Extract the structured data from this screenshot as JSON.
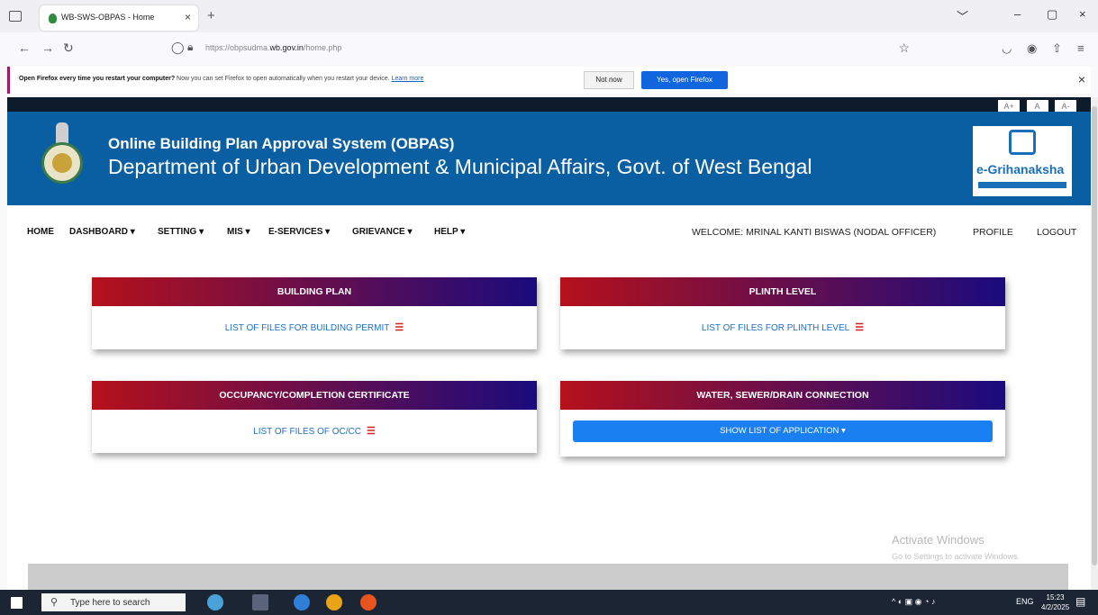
{
  "browser": {
    "tab_title": "WB-SWS-OBPAS - Home",
    "tab_close": "×",
    "new_tab": "+",
    "url_prefix": "https://obpsudma.",
    "url_domain": "wb.gov.in",
    "url_suffix": "/home.php",
    "window_controls": [
      "﹀",
      "–",
      "▢",
      "×"
    ]
  },
  "notification": {
    "bold": "Open Firefox every time you restart your computer?",
    "text": " Now you can set Firefox to open automatically when you restart your device. ",
    "learn_more": "Learn more",
    "not_now": "Not now",
    "yes_button": "Yes, open Firefox",
    "close": "×"
  },
  "font_controls": [
    "A+",
    "A",
    "A-"
  ],
  "header": {
    "title1": "Online Building Plan Approval System (OBPAS)",
    "title2": "Department of Urban Development & Municipal Affairs, Govt. of West Bengal",
    "logo_text": "e-Grihanaksha"
  },
  "menu": {
    "items": [
      "HOME",
      "DASHBOARD ▾",
      "SETTING ▾",
      "MIS ▾",
      "E-SERVICES ▾",
      "GRIEVANCE ▾",
      "HELP ▾"
    ],
    "welcome": "WELCOME: MRINAL KANTI BISWAS (NODAL OFFICER)",
    "profile": "PROFILE",
    "logout": "LOGOUT"
  },
  "cards": {
    "building_plan": {
      "title": "BUILDING PLAN",
      "link": "LIST OF FILES FOR BUILDING PERMIT"
    },
    "plinth_level": {
      "title": "PLINTH LEVEL",
      "link": "LIST OF FILES FOR PLINTH LEVEL"
    },
    "occupancy": {
      "title": "OCCUPANCY/COMPLETION CERTIFICATE",
      "link": "LIST OF FILES OF OC/CC"
    },
    "water": {
      "title": "WATER, SEWER/DRAIN CONNECTION",
      "button": "SHOW LIST OF APPLICATION ▾"
    }
  },
  "list_icon": "☰",
  "watermark": {
    "line1": "Activate Windows",
    "line2": "Go to Settings to activate Windows."
  },
  "taskbar": {
    "search_placeholder": "Type here to search",
    "lang": "ENG",
    "time": "15:23",
    "date": "4/2/2025"
  }
}
